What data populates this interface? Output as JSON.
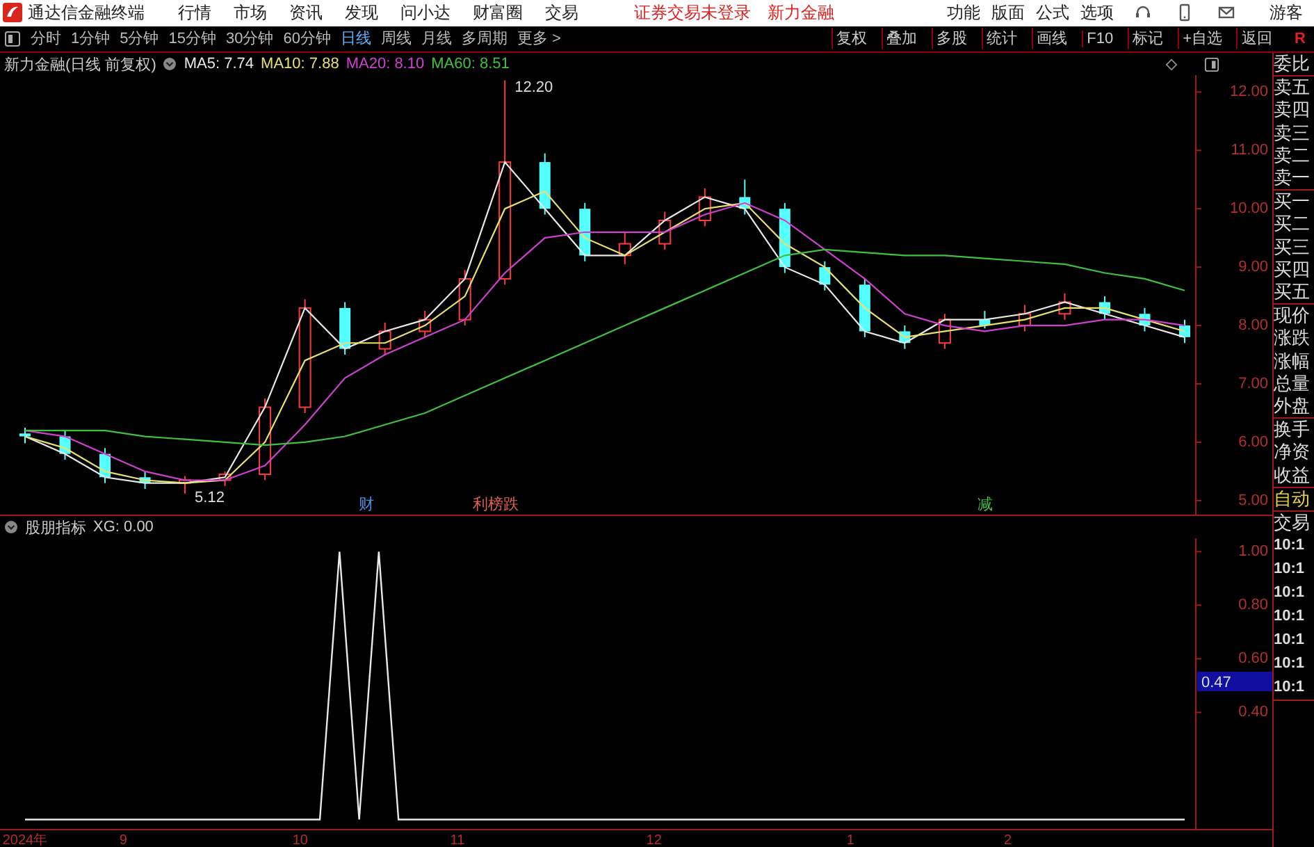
{
  "title_bar": {
    "app_name": "通达信金融终端",
    "menu": [
      "行情",
      "市场",
      "资讯",
      "发现",
      "问小达",
      "财富圈",
      "交易"
    ],
    "login_status": "证券交易未登录",
    "stock_name": "新力金融",
    "right_menu": [
      "功能",
      "版面",
      "公式",
      "选项"
    ],
    "user": "游客"
  },
  "toolbar": {
    "periods": [
      {
        "label": "分时",
        "selected": false
      },
      {
        "label": "1分钟",
        "selected": false
      },
      {
        "label": "5分钟",
        "selected": false
      },
      {
        "label": "15分钟",
        "selected": false
      },
      {
        "label": "30分钟",
        "selected": false
      },
      {
        "label": "60分钟",
        "selected": false
      },
      {
        "label": "日线",
        "selected": true
      },
      {
        "label": "周线",
        "selected": false
      },
      {
        "label": "月线",
        "selected": false
      },
      {
        "label": "多周期",
        "selected": false
      },
      {
        "label": "更多 >",
        "selected": false
      }
    ],
    "actions": [
      "复权",
      "叠加",
      "多股",
      "统计",
      "画线",
      "F10",
      "标记",
      "+自选",
      "返回"
    ],
    "corner": "R"
  },
  "price_chart": {
    "title": "新力金融(日线 前复权)",
    "legend_readings": [
      ": 7.74",
      ": 7.88",
      ": 8.10",
      ": 8.51"
    ],
    "price_labels": [
      "12.20",
      "5.12"
    ],
    "events": [
      {
        "text": "财",
        "color": "#4a90e0"
      },
      {
        "text": "利榜跌",
        "color": "#e06050"
      },
      {
        "text": "减",
        "color": "#40c040"
      }
    ],
    "candles": {
      "chart_data": {
        "type": "candlestick",
        "ylim": [
          4.76,
          12.29
        ],
        "yticks": [
          {
            "value": 12,
            "label": "12.00"
          },
          {
            "value": 10,
            "label": "10.00"
          },
          {
            "value": 8,
            "label": "8.00"
          },
          {
            "value": 6,
            "label": "6.00"
          }
        ],
        "categories": [
          null,
          null,
          null,
          null,
          null,
          null,
          null,
          null,
          null,
          null,
          null,
          null,
          null,
          null,
          null,
          null,
          null,
          null,
          null,
          null,
          null,
          null,
          null,
          null,
          null,
          null,
          null,
          null,
          null,
          null
        ],
        "ohlc": [
          [
            6.15,
            6.25,
            5.98,
            6.1
          ],
          [
            6.1,
            6.2,
            5.7,
            5.8
          ],
          [
            5.8,
            5.9,
            5.3,
            5.4
          ],
          [
            5.4,
            5.5,
            5.2,
            5.3
          ],
          [
            5.3,
            5.42,
            5.12,
            5.35
          ],
          [
            5.35,
            5.5,
            5.25,
            5.45
          ],
          [
            5.45,
            6.75,
            5.35,
            6.6
          ],
          [
            6.6,
            8.45,
            6.5,
            8.3
          ],
          [
            8.3,
            8.4,
            7.5,
            7.6
          ],
          [
            7.6,
            8.05,
            7.5,
            7.9
          ],
          [
            7.9,
            8.25,
            7.8,
            8.1
          ],
          [
            8.1,
            8.95,
            8.0,
            8.8
          ],
          [
            8.8,
            12.2,
            8.7,
            10.8
          ],
          [
            10.8,
            10.95,
            9.9,
            10.0
          ],
          [
            10.0,
            10.1,
            9.1,
            9.2
          ],
          [
            9.2,
            9.6,
            9.05,
            9.4
          ],
          [
            9.4,
            9.95,
            9.3,
            9.8
          ],
          [
            9.8,
            10.35,
            9.7,
            10.2
          ],
          [
            10.2,
            10.5,
            9.9,
            10.0
          ],
          [
            10.0,
            10.1,
            8.9,
            9.0
          ],
          [
            9.0,
            9.1,
            8.6,
            8.7
          ],
          [
            8.7,
            8.8,
            7.8,
            7.9
          ],
          [
            7.9,
            8.0,
            7.6,
            7.7
          ],
          [
            7.7,
            8.2,
            7.6,
            8.1
          ],
          [
            8.1,
            8.25,
            7.95,
            8.0
          ],
          [
            8.0,
            8.35,
            7.9,
            8.2
          ],
          [
            8.2,
            8.55,
            8.1,
            8.4
          ],
          [
            8.4,
            8.5,
            8.1,
            8.2
          ],
          [
            8.2,
            8.3,
            7.9,
            8.0
          ],
          [
            8.0,
            8.1,
            7.7,
            7.8
          ]
        ]
      }
    },
    "averages": {
      "chart_data": {
        "type": "line",
        "ylim": [
          4.76,
          12.29
        ],
        "yticks": [
          {
            "value": 11,
            "label": "11.00"
          },
          {
            "value": 9,
            "label": "9.00"
          },
          {
            "value": 7,
            "label": "7.00"
          },
          {
            "value": 5,
            "label": "5.00"
          }
        ],
        "categories": [
          null,
          null,
          null,
          null,
          null,
          null,
          null,
          null,
          null,
          null,
          null,
          null,
          null,
          null,
          null,
          null,
          null,
          null,
          null,
          null,
          null,
          null,
          null,
          null,
          null,
          null,
          null,
          null,
          null,
          null
        ],
        "series": [
          {
            "name": "MA5",
            "color": "#e8e8e8",
            "values": [
              6.1,
              5.8,
              5.4,
              5.3,
              5.3,
              5.4,
              6.6,
              8.3,
              7.6,
              7.9,
              8.1,
              8.8,
              10.8,
              10.0,
              9.2,
              9.2,
              9.8,
              10.2,
              10.0,
              9.0,
              8.7,
              7.9,
              7.7,
              8.1,
              8.1,
              8.2,
              8.4,
              8.2,
              8.0,
              7.8
            ]
          },
          {
            "name": "MA10",
            "color": "#e8e070",
            "values": [
              6.1,
              5.9,
              5.5,
              5.35,
              5.3,
              5.35,
              6.0,
              7.4,
              7.7,
              7.7,
              8.0,
              8.5,
              10.0,
              10.3,
              9.5,
              9.2,
              9.6,
              10.0,
              10.1,
              9.4,
              9.0,
              8.3,
              7.8,
              7.9,
              8.0,
              8.1,
              8.3,
              8.3,
              8.1,
              7.9
            ]
          },
          {
            "name": "MA20",
            "color": "#d040d0",
            "values": [
              6.2,
              6.1,
              5.8,
              5.5,
              5.35,
              5.35,
              5.6,
              6.3,
              7.1,
              7.5,
              7.8,
              8.1,
              8.9,
              9.5,
              9.6,
              9.6,
              9.6,
              9.9,
              10.1,
              9.8,
              9.3,
              8.8,
              8.2,
              8.0,
              7.9,
              8.0,
              8.0,
              8.1,
              8.1,
              8.0
            ]
          },
          {
            "name": "MA60",
            "color": "#40c040",
            "values": [
              6.2,
              6.2,
              6.2,
              6.1,
              6.05,
              6.0,
              5.95,
              6.0,
              6.1,
              6.3,
              6.5,
              6.8,
              7.1,
              7.4,
              7.7,
              8.0,
              8.3,
              8.6,
              8.9,
              9.2,
              9.3,
              9.25,
              9.2,
              9.2,
              9.15,
              9.1,
              9.05,
              8.9,
              8.8,
              8.6
            ]
          }
        ]
      }
    }
  },
  "indicator": {
    "title": "股朋指标",
    "reading": ": 0.00",
    "cursor_label": "0.47",
    "chart_data": {
      "type": "line",
      "ylim": [
        -0.035,
        1.05
      ],
      "yticks": [
        {
          "value": 1,
          "label": "1.00"
        },
        {
          "value": 0.8,
          "label": "0.80"
        },
        {
          "value": 0.6,
          "label": "0.60"
        },
        {
          "value": 0.4,
          "label": "0.40"
        }
      ],
      "categories": [
        "2024年",
        null,
        null,
        null,
        null,
        "9",
        null,
        null,
        null,
        null,
        null,
        null,
        null,
        null,
        "10",
        null,
        null,
        null,
        null,
        null,
        null,
        null,
        "11",
        null,
        null,
        null,
        null,
        null,
        null,
        null,
        null,
        null,
        "12",
        null,
        null,
        null,
        null,
        null,
        null,
        null,
        null,
        null,
        "1",
        null,
        null,
        null,
        null,
        null,
        null,
        null,
        "2",
        null,
        null,
        null,
        null,
        null,
        null,
        null,
        null,
        null
      ],
      "series": [
        {
          "name": "XG",
          "color": "#e8e8e8",
          "values": [
            0,
            0,
            0,
            0,
            0,
            0,
            0,
            0,
            0,
            0,
            0,
            0,
            0,
            0,
            0,
            0,
            1,
            0,
            1,
            0,
            0,
            0,
            0,
            0,
            0,
            0,
            0,
            0,
            0,
            0,
            0,
            0,
            0,
            0,
            0,
            0,
            0,
            0,
            0,
            0,
            0,
            0,
            0,
            0,
            0,
            0,
            0,
            0,
            0,
            0,
            0,
            0,
            0,
            0,
            0,
            0,
            0,
            0,
            0,
            0
          ]
        }
      ]
    }
  },
  "side_panel": {
    "sections": [
      [
        {
          "label": "委比",
          "kind": "label"
        }
      ],
      [
        {
          "label": "卖五",
          "kind": "label"
        },
        {
          "label": "卖四",
          "kind": "label"
        },
        {
          "label": "卖三",
          "kind": "label"
        },
        {
          "label": "卖二",
          "kind": "label"
        },
        {
          "label": "卖一",
          "kind": "label"
        }
      ],
      [
        {
          "label": "买一",
          "kind": "label"
        },
        {
          "label": "买二",
          "kind": "label"
        },
        {
          "label": "买三",
          "kind": "label"
        },
        {
          "label": "买四",
          "kind": "label"
        },
        {
          "label": "买五",
          "kind": "label"
        }
      ],
      [
        {
          "label": "现价",
          "kind": "label"
        },
        {
          "label": "涨跌",
          "kind": "label"
        },
        {
          "label": "涨幅",
          "kind": "label"
        },
        {
          "label": "总量",
          "kind": "label"
        },
        {
          "label": "外盘",
          "kind": "label"
        }
      ],
      [
        {
          "label": "换手",
          "kind": "label"
        },
        {
          "label": "净资",
          "kind": "label"
        },
        {
          "label": "收益",
          "kind": "label"
        }
      ],
      [
        {
          "label": "自动",
          "kind": "toggle"
        }
      ],
      [
        {
          "label": "交易",
          "kind": "label"
        },
        {
          "label": "10:1",
          "kind": "time"
        },
        {
          "label": "10:1",
          "kind": "time"
        },
        {
          "label": "10:1",
          "kind": "time"
        },
        {
          "label": "10:1",
          "kind": "time"
        },
        {
          "label": "10:1",
          "kind": "time"
        },
        {
          "label": "10:1",
          "kind": "time"
        },
        {
          "label": "10:1",
          "kind": "time"
        }
      ]
    ]
  }
}
